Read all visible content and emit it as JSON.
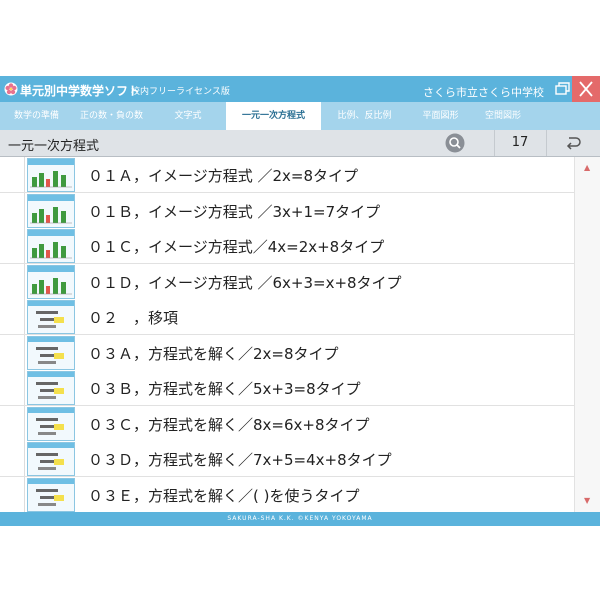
{
  "window": {
    "app_title": "単元別中学数学ソフト",
    "edition": "校内フリーライセンス版",
    "school": "さくら市立さくら中学校",
    "restore_icon": "restore-window-icon",
    "close_icon": "close-icon"
  },
  "tabs": [
    {
      "label": "数学の準備"
    },
    {
      "label": "正の数・負の数"
    },
    {
      "label": "文字式"
    },
    {
      "label": "一元一次方程式"
    },
    {
      "label": "比例、反比例"
    },
    {
      "label": "平面図形"
    },
    {
      "label": "空間図形"
    }
  ],
  "active_tab": "一元一次方程式",
  "section": {
    "title": "一元一次方程式",
    "count": "17",
    "search_icon": "search-icon",
    "back_icon": "return-arrow-icon"
  },
  "items": [
    {
      "label": "０１Ａ，イメージ方程式 ／2x=8タイプ"
    },
    {
      "label": "０１Ｂ，イメージ方程式 ／3x+1=7タイプ"
    },
    {
      "label": "０１Ｃ，イメージ方程式／4x=2x+8タイプ"
    },
    {
      "label": "０１Ｄ，イメージ方程式 ／6x+3=x+8タイプ"
    },
    {
      "label": "０２　，移項"
    },
    {
      "label": "０３Ａ，方程式を解く／2x=8タイプ"
    },
    {
      "label": "０３Ｂ，方程式を解く／5x+3=8タイプ"
    },
    {
      "label": "０３Ｃ，方程式を解く／8x=6x+8タイプ"
    },
    {
      "label": "０３Ｄ，方程式を解く／7x+5=4x+8タイプ"
    },
    {
      "label": "０３Ｅ，方程式を解く／( )を使うタイプ"
    }
  ],
  "footer": "SAKURA-SHA K.K.  ©KENYA YOKOYAMA",
  "colors": {
    "accent": "#5bb3dc",
    "tab_bar": "#a4d4ec",
    "close": "#e46a6a"
  }
}
